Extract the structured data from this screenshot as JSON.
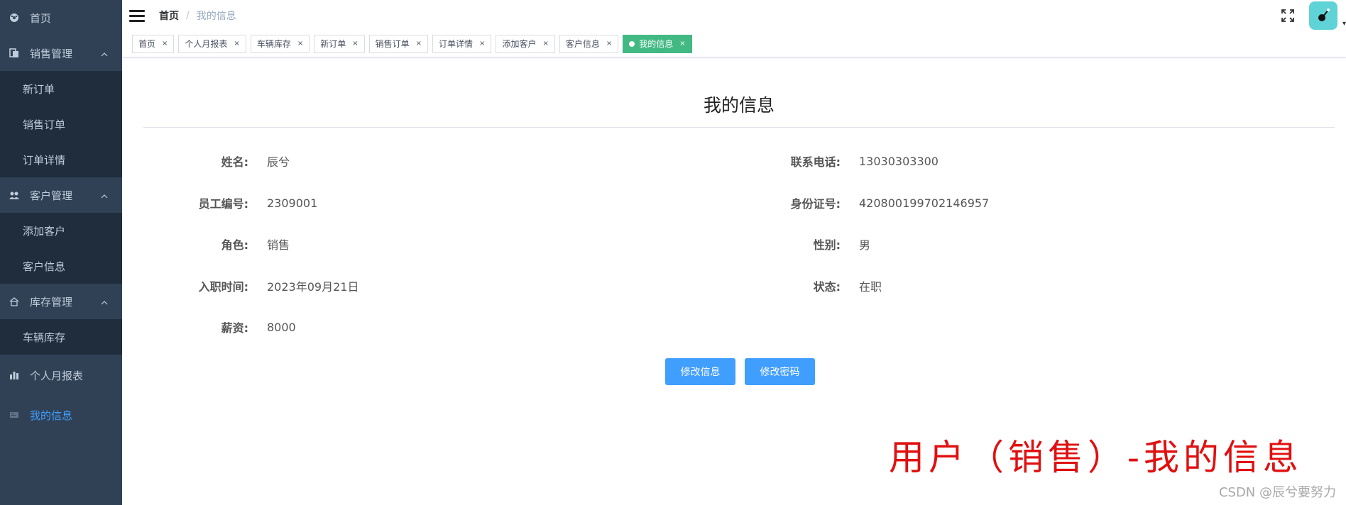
{
  "sidebar": {
    "home": "首页",
    "groups": [
      {
        "label": "销售管理",
        "icon": "clipboard-icon",
        "items": [
          "新订单",
          "销售订单",
          "订单详情"
        ]
      },
      {
        "label": "客户管理",
        "icon": "users-icon",
        "items": [
          "添加客户",
          "客户信息"
        ]
      },
      {
        "label": "库存管理",
        "icon": "home-icon",
        "items": [
          "车辆库存"
        ]
      }
    ],
    "report": "个人月报表",
    "myinfo": "我的信息"
  },
  "navbar": {
    "breadcrumb": [
      "首页",
      "/",
      "我的信息"
    ]
  },
  "tags": [
    "首页",
    "个人月报表",
    "车辆库存",
    "新订单",
    "销售订单",
    "订单详情",
    "添加客户",
    "客户信息",
    "我的信息"
  ],
  "tag_close": "×",
  "page": {
    "title": "我的信息",
    "fields": {
      "name": {
        "label": "姓名:",
        "value": "辰兮"
      },
      "phone": {
        "label": "联系电话:",
        "value": "13030303300"
      },
      "emp_no": {
        "label": "员工编号:",
        "value": "2309001"
      },
      "id_no": {
        "label": "身份证号:",
        "value": "420800199702146957"
      },
      "role": {
        "label": "角色:",
        "value": "销售"
      },
      "gender": {
        "label": "性别:",
        "value": "男"
      },
      "hire_date": {
        "label": "入职时间:",
        "value": "2023年09月21日"
      },
      "status": {
        "label": "状态:",
        "value": "在职"
      },
      "salary": {
        "label": "薪资:",
        "value": "8000"
      }
    },
    "buttons": {
      "edit_info": "修改信息",
      "edit_password": "修改密码"
    }
  },
  "caption": "用户（销售）-我的信息",
  "watermark": "CSDN @辰兮要努力",
  "colors": {
    "sidebar_bg": "#304156",
    "submenu_bg": "#1f2d3d",
    "accent": "#409eff",
    "active_tag": "#42b983"
  }
}
